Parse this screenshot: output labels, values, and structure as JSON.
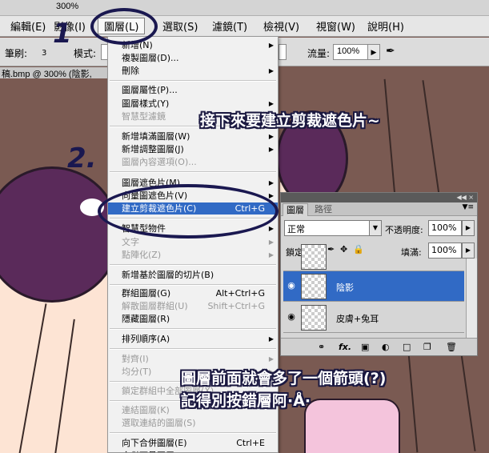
{
  "topbar": {
    "zoom": "300%"
  },
  "menubar": {
    "items": [
      "編輯(E)",
      "影像(I)",
      "圖層(L)",
      "選取(S)",
      "濾鏡(T)",
      "檢視(V)",
      "視窗(W)",
      "說明(H)"
    ]
  },
  "options": {
    "brush_label": "筆刷:",
    "brush_size": "3",
    "mode_label": "模式:",
    "flow_label": "流量:",
    "flow_value": "100%"
  },
  "document": {
    "tab_title": "稿.bmp @ 300% (陰影,"
  },
  "menu": {
    "items": [
      {
        "label": "新增(N)",
        "shortcut": "",
        "submenu": true,
        "disabled": false
      },
      {
        "label": "複製圖層(D)...",
        "shortcut": "",
        "submenu": false,
        "disabled": false
      },
      {
        "label": "刪除",
        "shortcut": "",
        "submenu": true,
        "disabled": false
      },
      {
        "label": "圖層屬性(P)...",
        "shortcut": "",
        "submenu": false,
        "disabled": false
      },
      {
        "label": "圖層樣式(Y)",
        "shortcut": "",
        "submenu": true,
        "disabled": false
      },
      {
        "label": "智慧型濾鏡",
        "shortcut": "",
        "submenu": true,
        "disabled": true
      },
      {
        "label": "新增填滿圖層(W)",
        "shortcut": "",
        "submenu": true,
        "disabled": false
      },
      {
        "label": "新增調整圖層(J)",
        "shortcut": "",
        "submenu": true,
        "disabled": false
      },
      {
        "label": "圖層內容選項(O)...",
        "shortcut": "",
        "submenu": false,
        "disabled": true
      },
      {
        "label": "圖層遮色片(M)",
        "shortcut": "",
        "submenu": true,
        "disabled": false
      },
      {
        "label": "向量圖遮色片(V)",
        "shortcut": "",
        "submenu": true,
        "disabled": false
      },
      {
        "label": "建立剪裁遮色片(C)",
        "shortcut": "Ctrl+G",
        "submenu": false,
        "disabled": false,
        "highlighted": true
      },
      {
        "label": "智慧型物件",
        "shortcut": "",
        "submenu": true,
        "disabled": false
      },
      {
        "label": "文字",
        "shortcut": "",
        "submenu": true,
        "disabled": true
      },
      {
        "label": "點陣化(Z)",
        "shortcut": "",
        "submenu": true,
        "disabled": true
      },
      {
        "label": "新增基於圖層的切片(B)",
        "shortcut": "",
        "submenu": false,
        "disabled": false
      },
      {
        "label": "群組圖層(G)",
        "shortcut": "Alt+Ctrl+G",
        "submenu": false,
        "disabled": false
      },
      {
        "label": "解散圖層群組(U)",
        "shortcut": "Shift+Ctrl+G",
        "submenu": false,
        "disabled": true
      },
      {
        "label": "隱藏圖層(R)",
        "shortcut": "",
        "submenu": false,
        "disabled": false
      },
      {
        "label": "排列順序(A)",
        "shortcut": "",
        "submenu": true,
        "disabled": false
      },
      {
        "label": "對齊(I)",
        "shortcut": "",
        "submenu": true,
        "disabled": true
      },
      {
        "label": "均分(T)",
        "shortcut": "",
        "submenu": true,
        "disabled": true
      },
      {
        "label": "鎖定群組中全部圖層(X)...",
        "shortcut": "",
        "submenu": false,
        "disabled": true
      },
      {
        "label": "連結圖層(K)",
        "shortcut": "",
        "submenu": false,
        "disabled": true
      },
      {
        "label": "選取連結的圖層(S)",
        "shortcut": "",
        "submenu": false,
        "disabled": true
      },
      {
        "label": "向下合併圖層(E)",
        "shortcut": "Ctrl+E",
        "submenu": false,
        "disabled": false
      },
      {
        "label": "合併可見圖層",
        "shortcut": "Shift+Ctrl+E",
        "submenu": false,
        "disabled": false
      }
    ]
  },
  "layers_panel": {
    "tabs": [
      "圖層",
      "路徑"
    ],
    "blend_mode": "正常",
    "opacity_label": "不透明度:",
    "opacity_value": "100%",
    "lock_label": "鎖定:",
    "fill_label": "填滿:",
    "fill_value": "100%",
    "layers": [
      {
        "name": "陰影",
        "active": true
      },
      {
        "name": "皮膚+兔耳",
        "active": false
      }
    ],
    "footer_fx": "fx."
  },
  "annotations": {
    "step1": "1",
    "step2": "2.",
    "caption_top": "接下來要建立剪裁遮色片~",
    "caption_bottom_1": "圖層前面就會多了一個箭頭(?)",
    "caption_bottom_2": "記得別按錯層阿·Å·"
  }
}
